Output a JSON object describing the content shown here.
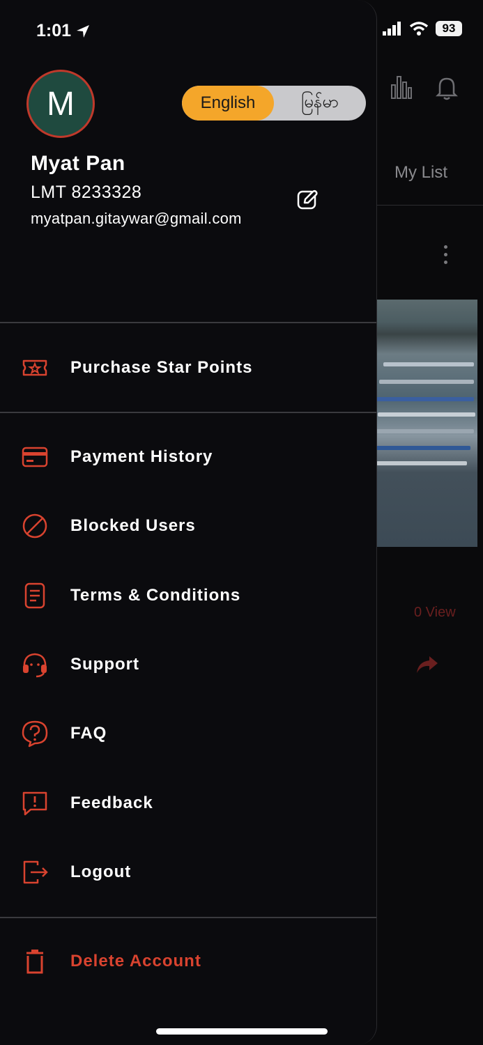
{
  "status_bar": {
    "time": "1:01",
    "battery": "93"
  },
  "background": {
    "tab_label": "My List",
    "views_label": "0 View"
  },
  "profile": {
    "avatar_initial": "M",
    "name": "Myat Pan",
    "id": "LMT 8233328",
    "email": "myatpan.gitaywar@gmail.com"
  },
  "language_toggle": {
    "options": [
      "English",
      "မြန်မာ"
    ],
    "selected": "English"
  },
  "menu": {
    "purchase": {
      "label": "Purchase Star Points",
      "icon": "ticket-star-icon"
    },
    "items": [
      {
        "label": "Payment History",
        "icon": "credit-card-icon"
      },
      {
        "label": "Blocked Users",
        "icon": "blocked-icon"
      },
      {
        "label": "Terms & Conditions",
        "icon": "document-icon"
      },
      {
        "label": "Support",
        "icon": "headset-icon"
      },
      {
        "label": "FAQ",
        "icon": "question-icon"
      },
      {
        "label": "Feedback",
        "icon": "feedback-icon"
      },
      {
        "label": "Logout",
        "icon": "logout-icon"
      }
    ],
    "delete_account": {
      "label": "Delete Account",
      "icon": "trash-icon"
    }
  },
  "colors": {
    "accent": "#d9432f",
    "toggle_active": "#f4a62a",
    "drawer_bg": "#0b0b0e"
  }
}
